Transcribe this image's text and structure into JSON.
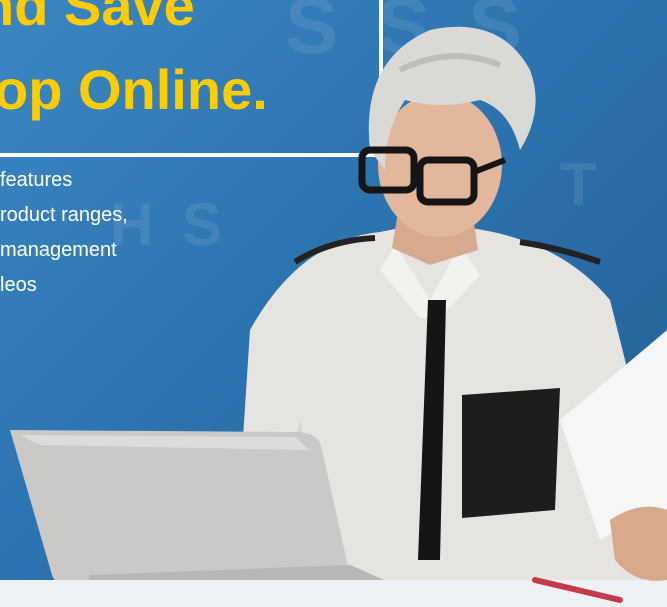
{
  "headline": {
    "line1": "nd Save",
    "line2": "op Online."
  },
  "copy": {
    "lines": [
      "features",
      "roduct ranges,",
      "management",
      "leos"
    ]
  },
  "colors": {
    "background": "#2c74b0",
    "headline": "#ffcc00",
    "copy": "#ffffff",
    "frame": "#ffffff"
  }
}
